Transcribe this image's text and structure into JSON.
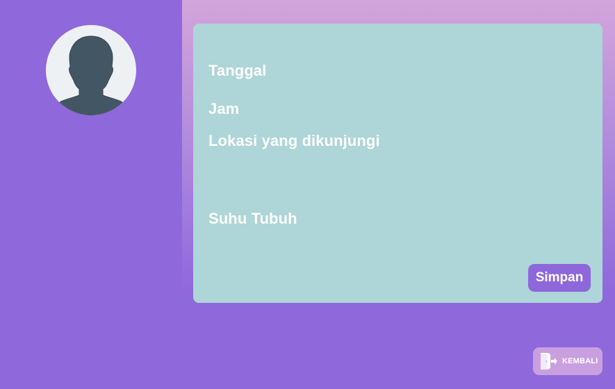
{
  "form": {
    "fields": {
      "tanggal_label": "Tanggal",
      "jam_label": "Jam",
      "lokasi_label": "Lokasi yang dikunjungi",
      "suhu_label": "Suhu Tubuh"
    },
    "save_label": "Simpan"
  },
  "footer": {
    "back_label": "KEMBALI"
  },
  "icons": {
    "avatar": "user-silhouette-icon",
    "back": "exit-door-icon"
  },
  "colors": {
    "background": "#8f68dc",
    "gradient_top": "#d4a5db",
    "card": "#aed5d8",
    "button": "#8e67db",
    "back_button": "#c9a0df",
    "text": "#ffffff",
    "avatar_bg": "#edf1f4",
    "avatar_silhouette": "#435663"
  }
}
